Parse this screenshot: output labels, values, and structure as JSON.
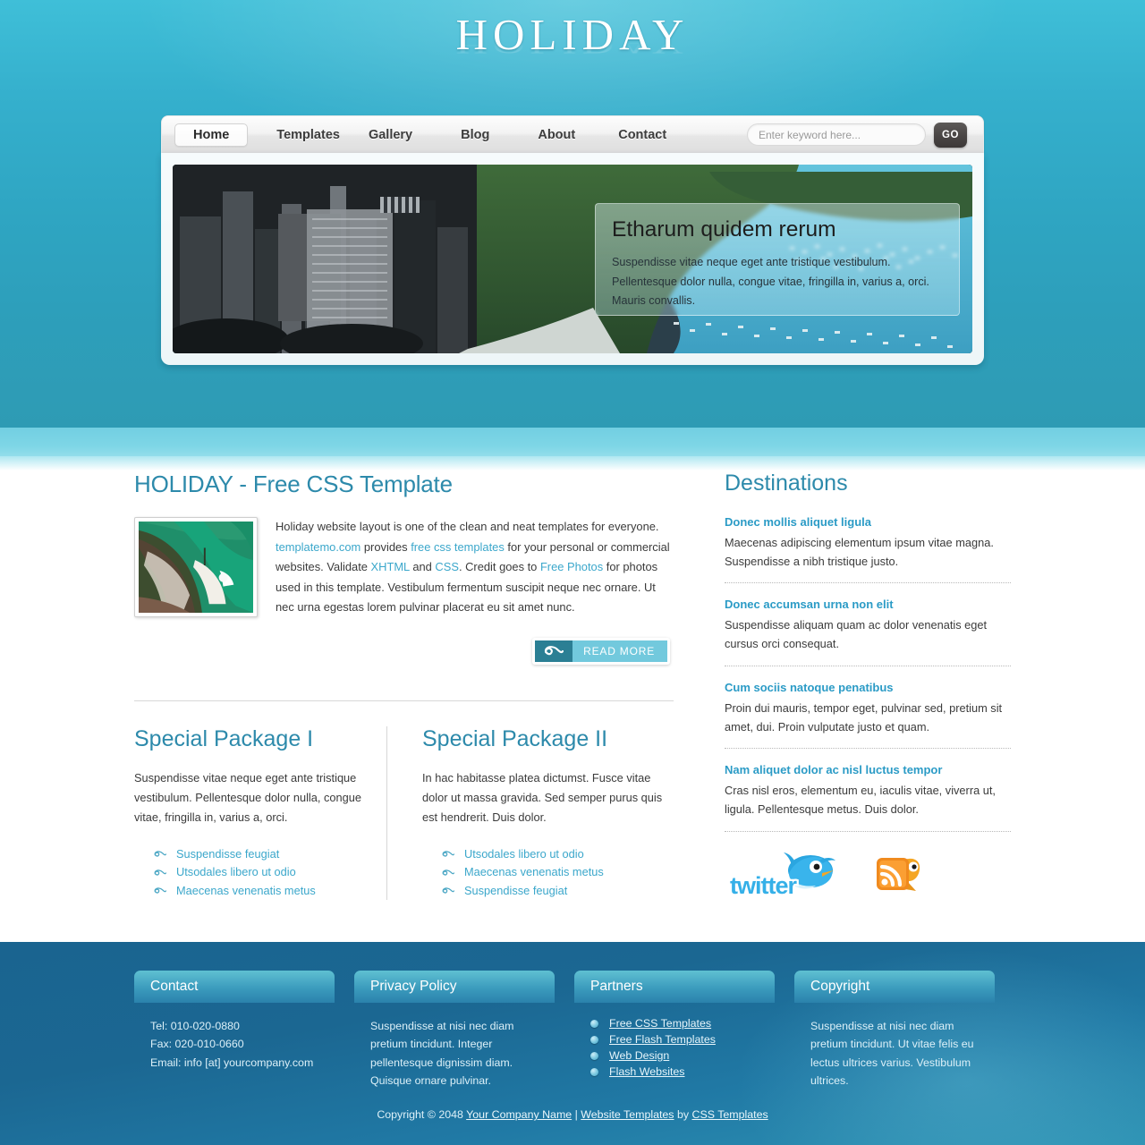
{
  "site": {
    "logo": "HOLIDAY"
  },
  "nav": {
    "items": [
      {
        "label": "Home",
        "active": true
      },
      {
        "label": "Templates",
        "active": false
      },
      {
        "label": "Gallery",
        "active": false
      },
      {
        "label": "Blog",
        "active": false
      },
      {
        "label": "About",
        "active": false
      },
      {
        "label": "Contact",
        "active": false
      }
    ]
  },
  "search": {
    "placeholder": "Enter keyword here...",
    "value": "",
    "button": "GO"
  },
  "banner": {
    "title": "Etharum quidem rerum",
    "desc": "Suspendisse vitae neque eget ante tristique vestibulum. Pellentesque dolor nulla, congue vitae, fringilla in, varius a, orci. Mauris convallis."
  },
  "main": {
    "title": "HOLIDAY - Free CSS Template",
    "intro": {
      "t1": "Holiday website layout is one of the clean and neat templates for everyone. ",
      "l1": "templatemo.com",
      "t2": " provides ",
      "l2": "free css templates",
      "t3": " for your personal or commercial websites. Validate ",
      "l3": "XHTML",
      "t4": " and ",
      "l4": "CSS",
      "t5": ". Credit goes to ",
      "l5": "Free Photos",
      "t6": " for photos used in this template. Vestibulum fermentum suscipit neque nec ornare. Ut nec urna egestas lorem pulvinar placerat eu sit amet nunc."
    },
    "read_more": "READ MORE"
  },
  "packages": [
    {
      "title": "Special Package I",
      "text": "Suspendisse vitae neque eget ante tristique vestibulum. Pellentesque dolor nulla, congue vitae, fringilla in, varius a, orci.",
      "links": [
        "Suspendisse feugiat",
        "Utsodales libero ut odio",
        "Maecenas venenatis metus"
      ]
    },
    {
      "title": "Special Package II",
      "text": "In hac habitasse platea dictumst. Fusce vitae dolor ut massa gravida. Sed semper purus quis est hendrerit. Duis dolor.",
      "links": [
        "Utsodales libero ut odio",
        "Maecenas venenatis metus",
        "Suspendisse feugiat"
      ]
    }
  ],
  "destinations": {
    "title": "Destinations",
    "items": [
      {
        "heading": "Donec mollis aliquet ligula",
        "text": "Maecenas adipiscing elementum ipsum vitae magna. Suspendisse a nibh tristique justo."
      },
      {
        "heading": "Donec accumsan urna non elit",
        "text": "Suspendisse aliquam quam ac dolor venenatis eget cursus orci consequat."
      },
      {
        "heading": "Cum sociis natoque penatibus",
        "text": "Proin dui mauris, tempor eget, pulvinar sed, pretium sit amet, dui. Proin vulputate justo et quam."
      },
      {
        "heading": "Nam aliquet dolor ac nisl luctus tempor",
        "text": "Cras nisl eros, elementum eu, iaculis vitae, viverra ut, ligula. Pellentesque metus. Duis dolor."
      }
    ]
  },
  "social": {
    "twitter": "twitter",
    "rss": "rss-feed"
  },
  "footer": {
    "contact": {
      "title": "Contact",
      "tel": "Tel: 010-020-0880",
      "fax": "Fax: 020-010-0660",
      "email": "Email: info [at] yourcompany.com"
    },
    "privacy": {
      "title": "Privacy Policy",
      "text": "Suspendisse at nisi nec diam pretium tincidunt. Integer pellentesque dignissim diam. Quisque ornare pulvinar."
    },
    "partners": {
      "title": "Partners",
      "links": [
        "Free CSS Templates",
        "Free Flash Templates",
        "Web Design",
        "Flash Websites"
      ]
    },
    "copyright_col": {
      "title": "Copyright",
      "text": "Suspendisse at nisi nec diam pretium tincidunt. Ut vitae felis eu lectus ultrices varius. Vestibulum ultrices."
    },
    "bottom": {
      "pre": "Copyright © 2048 ",
      "company": "Your Company Name",
      "sep": " | ",
      "templates": "Website Templates",
      "by": " by ",
      "css": "CSS Templates"
    }
  },
  "colors": {
    "accent_teal": "#2d8aab",
    "link_blue": "#3ba7cb",
    "header_bg": "#2fa6c3",
    "footer_bg": "#1a6490"
  }
}
